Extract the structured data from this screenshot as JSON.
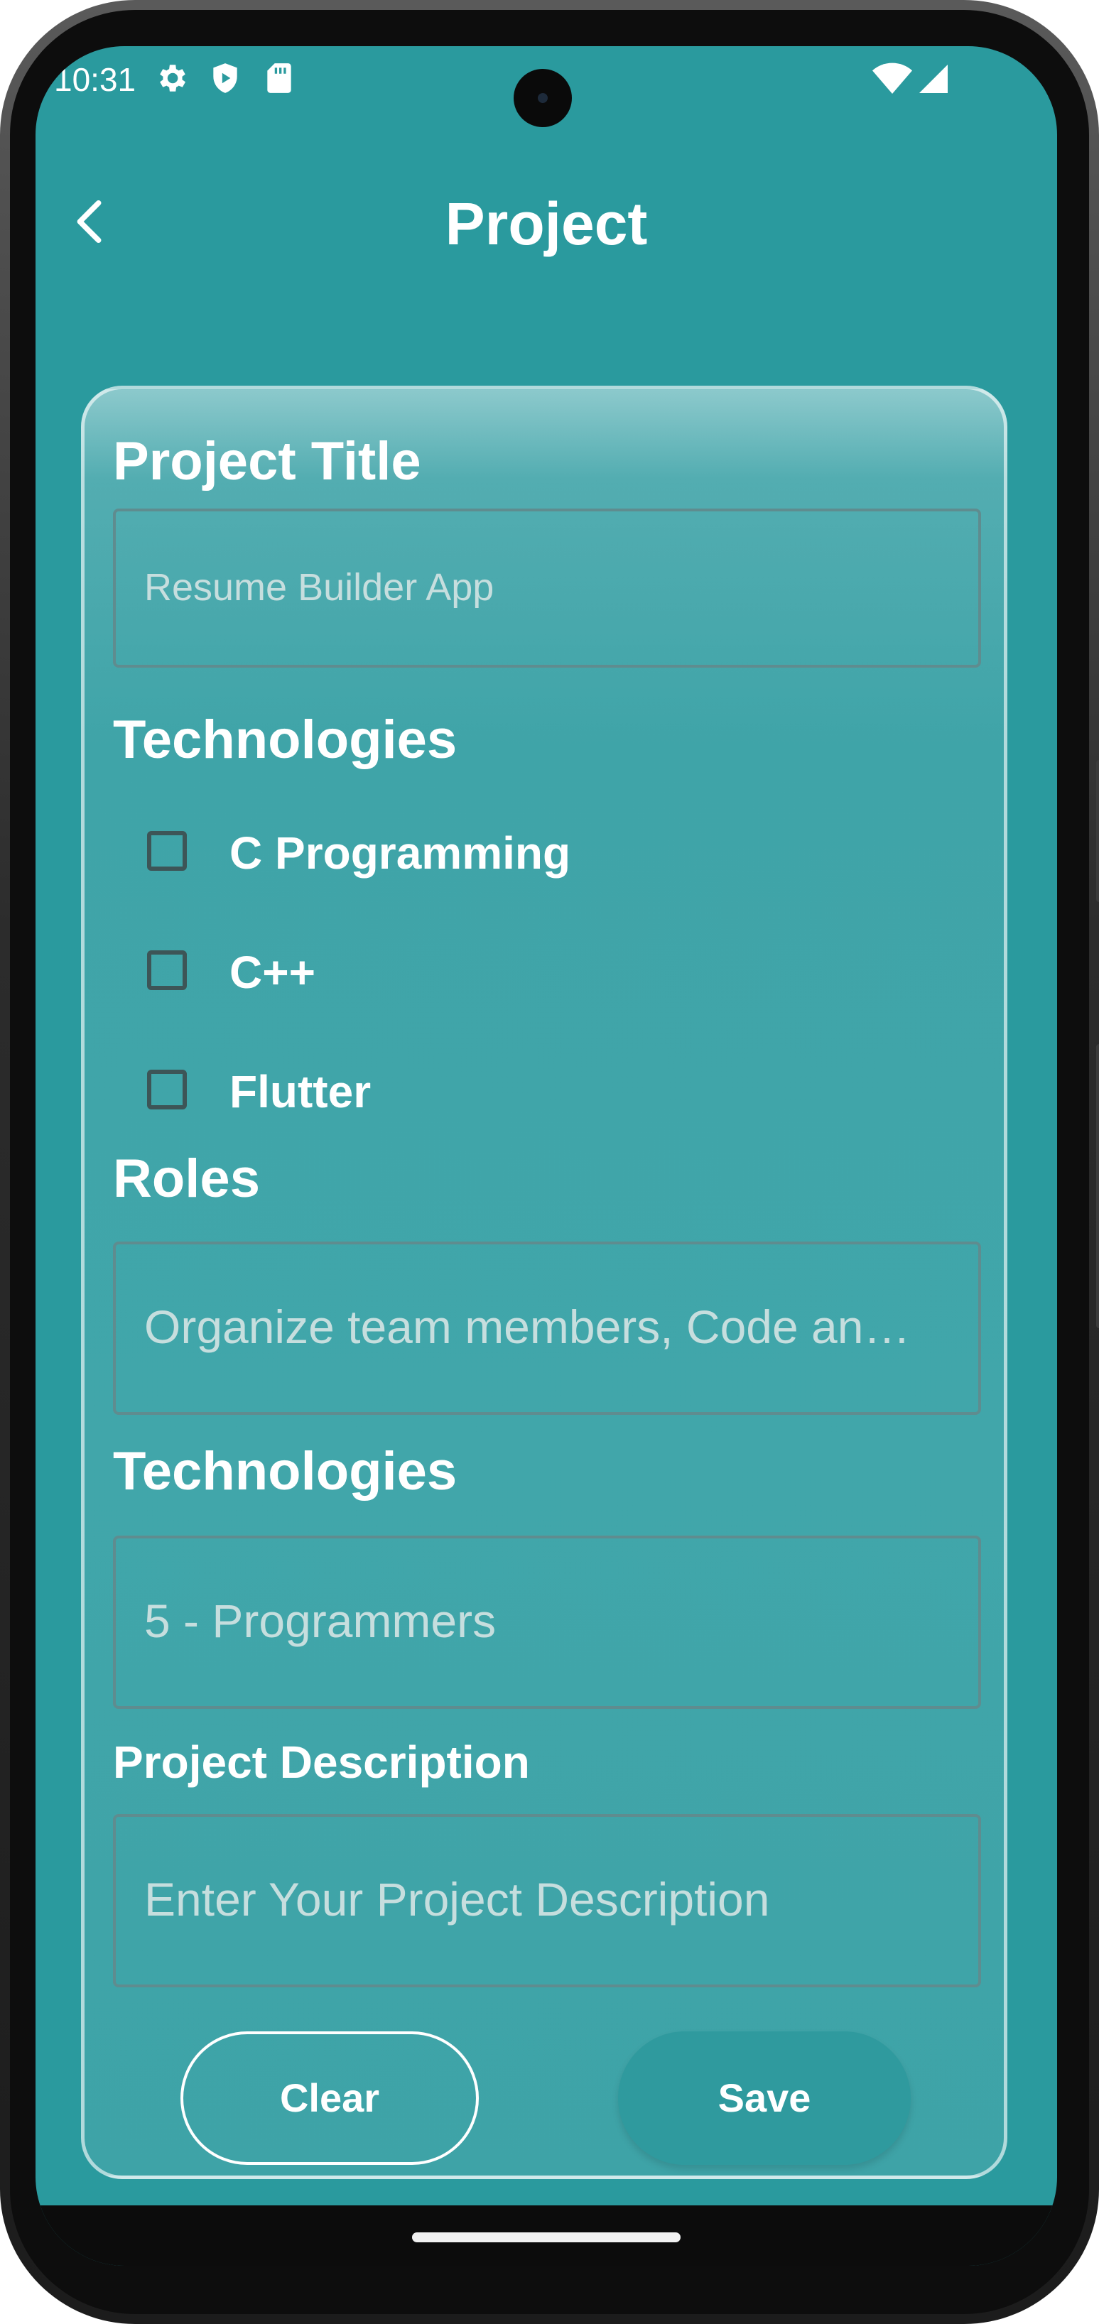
{
  "status_bar": {
    "time": "10:31"
  },
  "app_bar": {
    "title": "Project"
  },
  "form": {
    "project_title": {
      "label": "Project Title",
      "value": "Resume Builder App"
    },
    "technologies_checkboxes": {
      "label": "Technologies",
      "options": [
        "C Programming",
        "C++",
        "Flutter"
      ]
    },
    "roles": {
      "label": "Roles",
      "value": "Organize team members, Code an…"
    },
    "technologies_field": {
      "label": "Technologies",
      "value": "5 - Programmers"
    },
    "project_description": {
      "label": "Project Description",
      "placeholder": "Enter Your Project Description"
    }
  },
  "buttons": {
    "clear": "Clear",
    "save": "Save"
  },
  "colors": {
    "background": "#2a9a9e",
    "card": "#41a6aa",
    "text": "#ffffff",
    "hint": "#c6dede"
  }
}
